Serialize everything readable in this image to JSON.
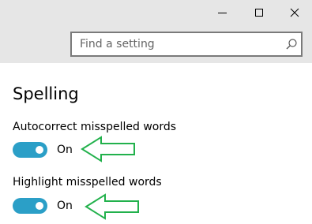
{
  "window": {
    "buttons": [
      "minimize",
      "maximize",
      "close"
    ]
  },
  "search": {
    "placeholder": "Find a setting",
    "value": "",
    "icon": "search-icon"
  },
  "section": {
    "title": "Spelling"
  },
  "settings": [
    {
      "label": "Autocorrect misspelled words",
      "state": "On",
      "enabled": true
    },
    {
      "label": "Highlight misspelled words",
      "state": "On",
      "enabled": true
    }
  ],
  "annotations": {
    "arrow_color": "#22b14c",
    "arrow_count": 2
  },
  "colors": {
    "accent": "#2b9fc7",
    "titlebar": "#e6e6e6"
  }
}
